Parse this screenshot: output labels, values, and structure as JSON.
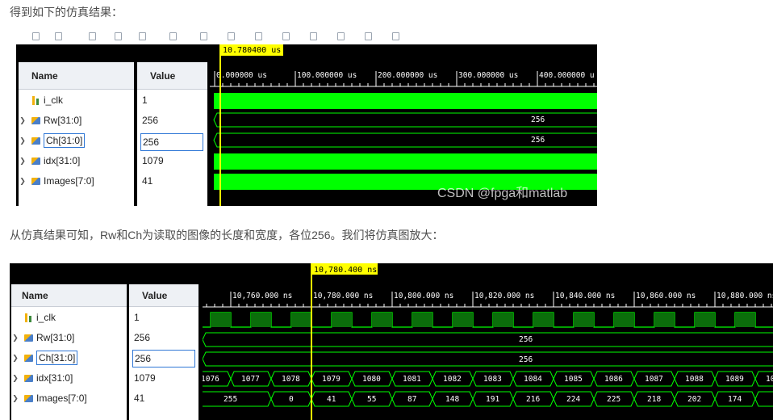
{
  "text": {
    "intro": "得到如下的仿真结果：",
    "middle": "从仿真结果可知，Rw和Ch为读取的图像的长度和宽度，各位256。我们将仿真图放大：",
    "watermark": "CSDN @fpga和matlab"
  },
  "headers": {
    "name": "Name",
    "value": "Value"
  },
  "signals": [
    {
      "name": "i_clk",
      "value": "1",
      "kind": "clock"
    },
    {
      "name": "Rw[31:0]",
      "value": "256",
      "kind": "bus"
    },
    {
      "name": "Ch[31:0]",
      "value": "256",
      "kind": "bus",
      "selected": true
    },
    {
      "name": "idx[31:0]",
      "value": "1079",
      "kind": "bus"
    },
    {
      "name": "Images[7:0]",
      "value": "41",
      "kind": "bus"
    }
  ],
  "wave1": {
    "cursor_label": "10.780400 us",
    "ticks": [
      "0.000000 us",
      "100.000000 us",
      "200.000000 us",
      "300.000000 us",
      "400.000000 u"
    ],
    "rw_label": "256",
    "ch_label": "256"
  },
  "wave2": {
    "cursor_label": "10,780.400 ns",
    "ticks": [
      "10,760.000 ns",
      "10,780.000 ns",
      "10,800.000 ns",
      "10,820.000 ns",
      "10,840.000 ns",
      "10,860.000 ns",
      "10,880.000 ns"
    ],
    "rw_label": "256",
    "ch_label": "256",
    "idx_values": [
      "1076",
      "1077",
      "1078",
      "1079",
      "1080",
      "1081",
      "1082",
      "1083",
      "1084",
      "1085",
      "1086",
      "1087",
      "1088",
      "1089",
      "10"
    ],
    "img_values": [
      "255",
      "0",
      "41",
      "55",
      "87",
      "148",
      "191",
      "216",
      "224",
      "225",
      "218",
      "202",
      "174",
      "1"
    ]
  },
  "colors": {
    "wave": "#00ff00",
    "cursor": "#ffff00",
    "selection": "#2f77d6"
  }
}
